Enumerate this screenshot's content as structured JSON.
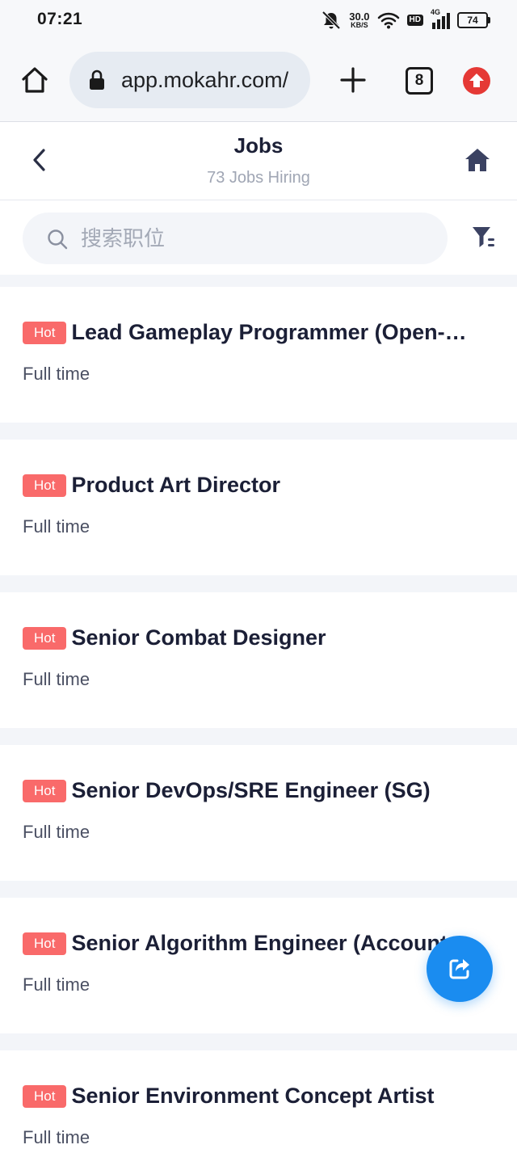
{
  "status_bar": {
    "time": "07:21",
    "net_speed_value": "30.0",
    "net_speed_unit": "KB/S",
    "hd_label": "HD",
    "network_label": "4G",
    "battery_level": "74"
  },
  "browser": {
    "url": "app.mokahr.com/",
    "tab_count": "8"
  },
  "header": {
    "title": "Jobs",
    "subtitle": "73 Jobs Hiring"
  },
  "search": {
    "placeholder": "搜索职位"
  },
  "jobs": [
    {
      "badge": "Hot",
      "title": "Lead Gameplay Programmer (Open-W…",
      "type": "Full time"
    },
    {
      "badge": "Hot",
      "title": "Product Art Director",
      "type": "Full time"
    },
    {
      "badge": "Hot",
      "title": "Senior Combat Designer",
      "type": "Full time"
    },
    {
      "badge": "Hot",
      "title": "Senior DevOps/SRE Engineer (SG)",
      "type": "Full time"
    },
    {
      "badge": "Hot",
      "title": "Senior Algorithm Engineer (Account…",
      "type": "Full time"
    },
    {
      "badge": "Hot",
      "title": "Senior Environment Concept Artist",
      "type": "Full time"
    }
  ],
  "colors": {
    "hot_badge": "#f96a6a",
    "fab": "#1a8cf0",
    "update_button": "#e53935",
    "title_text": "#1b1f36",
    "subtitle_text": "#a0a6b4"
  }
}
